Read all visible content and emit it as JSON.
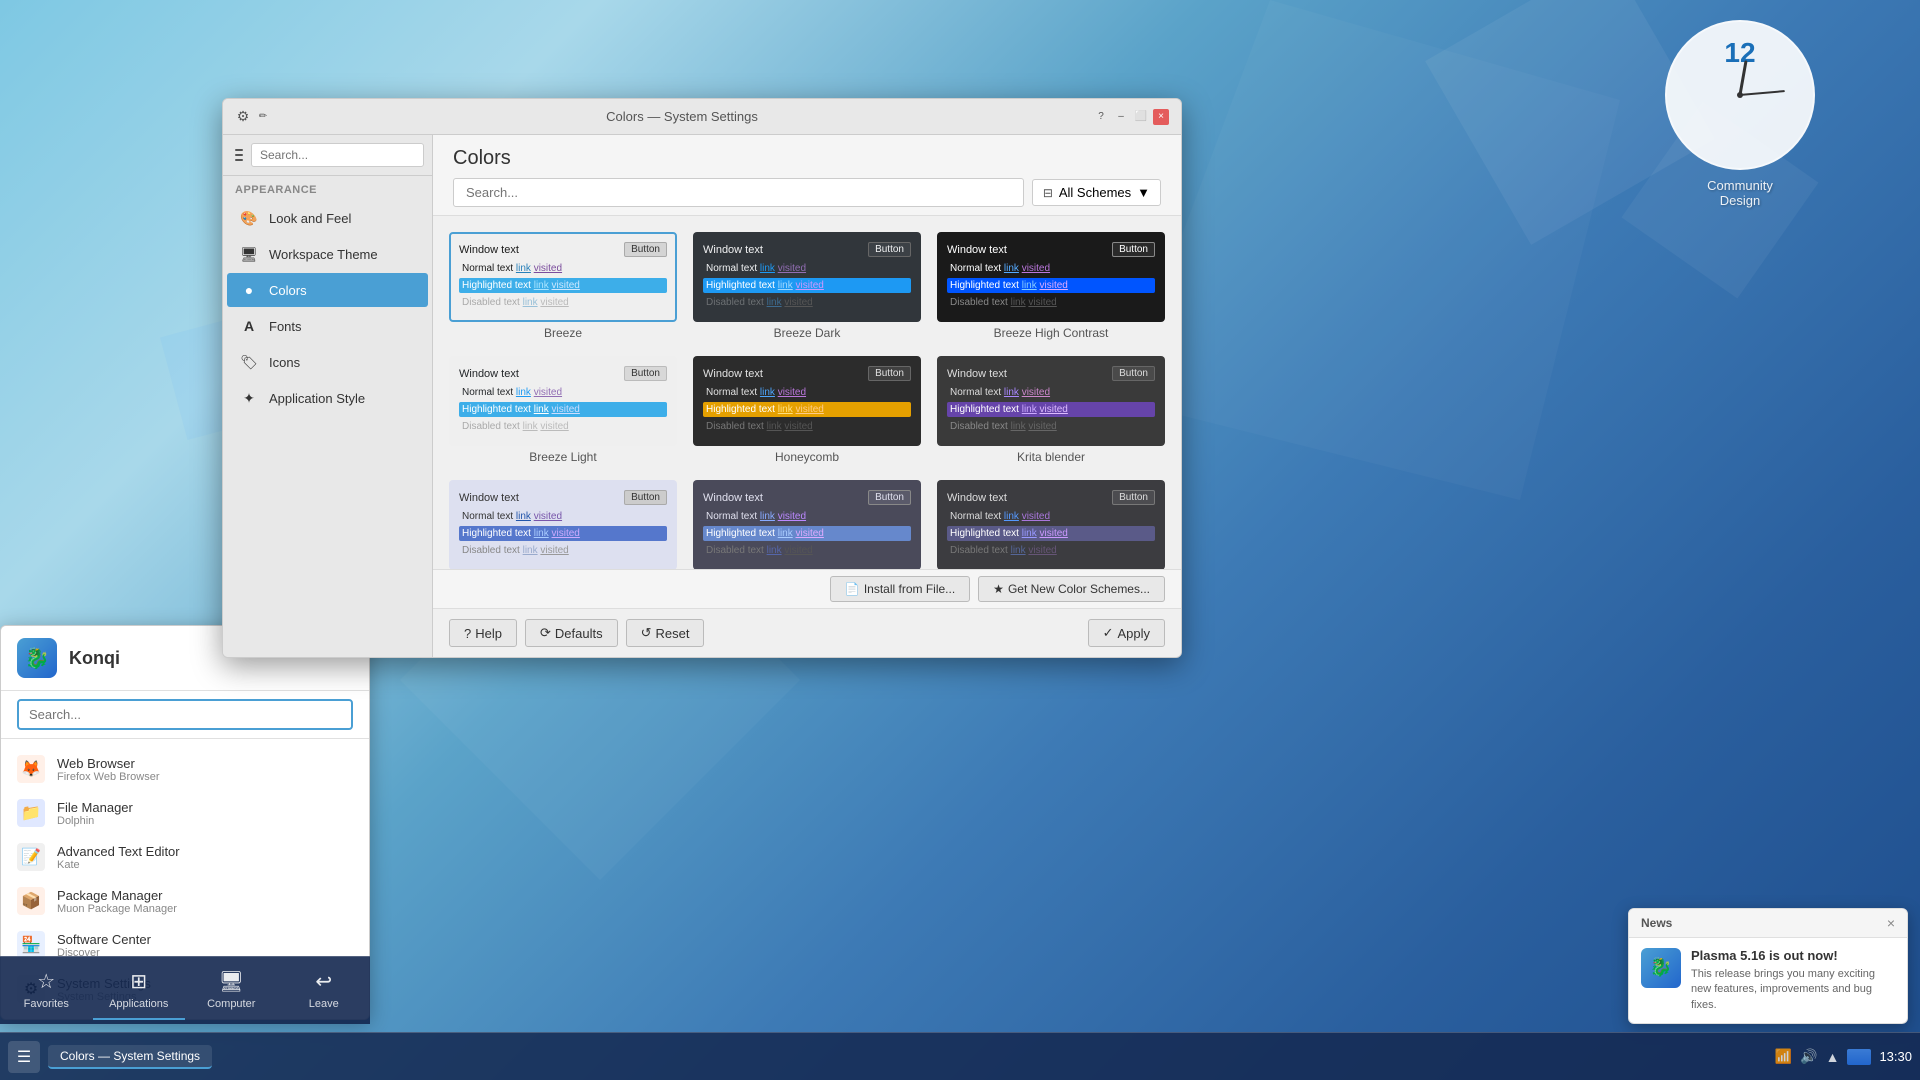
{
  "window": {
    "title": "Colors — System Settings",
    "controls": {
      "close": "×",
      "minimize": "–",
      "maximize": "⬜"
    }
  },
  "sidebar": {
    "search_placeholder": "Search...",
    "section_label": "Appearance",
    "items": [
      {
        "id": "look-and-feel",
        "label": "Look and Feel",
        "icon": "🎨"
      },
      {
        "id": "workspace-theme",
        "label": "Workspace Theme",
        "icon": "🖥"
      },
      {
        "id": "colors",
        "label": "Colors",
        "icon": "🎨",
        "active": true
      },
      {
        "id": "fonts",
        "label": "Fonts",
        "icon": "A"
      },
      {
        "id": "icons",
        "label": "Icons",
        "icon": "🏷"
      },
      {
        "id": "application-style",
        "label": "Application Style",
        "icon": "✦"
      }
    ]
  },
  "content": {
    "title": "Colors",
    "search_placeholder": "Search...",
    "filter_label": "All Schemes",
    "filter_icon": "▼"
  },
  "schemes": [
    {
      "id": "breeze",
      "label": "Breeze",
      "selected": true,
      "theme": "breeze",
      "window_text": "Window text",
      "button_label": "Button",
      "normal_text": "Normal text",
      "link_text": "link",
      "visited_text": "visited",
      "highlight_text": "Highlighted text",
      "highlight_link": "link",
      "highlight_visited": "visited",
      "disabled_text": "Disabled text",
      "disabled_link": "link",
      "disabled_visited": "visited"
    },
    {
      "id": "breeze-dark",
      "label": "Breeze Dark",
      "selected": false,
      "theme": "breeze-dark",
      "window_text": "Window text",
      "button_label": "Button",
      "normal_text": "Normal text",
      "link_text": "link",
      "visited_text": "visited",
      "highlight_text": "Highlighted text",
      "highlight_link": "link",
      "highlight_visited": "visited",
      "disabled_text": "Disabled text",
      "disabled_link": "link",
      "disabled_visited": "visited"
    },
    {
      "id": "breeze-high-contrast",
      "label": "Breeze High Contrast",
      "selected": false,
      "theme": "breeze-hc",
      "window_text": "Window text",
      "button_label": "Button",
      "normal_text": "Normal text",
      "link_text": "link",
      "visited_text": "visited",
      "highlight_text": "Highlighted text",
      "highlight_link": "link",
      "highlight_visited": "visited",
      "disabled_text": "Disabled text",
      "disabled_link": "link",
      "disabled_visited": "visited"
    },
    {
      "id": "breeze-light",
      "label": "Breeze Light",
      "selected": false,
      "theme": "breeze-light",
      "window_text": "Window text",
      "button_label": "Button",
      "normal_text": "Normal text",
      "link_text": "link",
      "visited_text": "visited",
      "highlight_text": "Highlighted text",
      "highlight_link": "link",
      "highlight_visited": "visited",
      "disabled_text": "Disabled text",
      "disabled_link": "link",
      "disabled_visited": "visited"
    },
    {
      "id": "honeycomb",
      "label": "Honeycomb",
      "selected": false,
      "theme": "honeycomb",
      "window_text": "Window text",
      "button_label": "Button",
      "normal_text": "Normal text",
      "link_text": "link",
      "visited_text": "visited",
      "highlight_text": "Highlighted text",
      "highlight_link": "link",
      "highlight_visited": "visited",
      "disabled_text": "Disabled text",
      "disabled_link": "link",
      "disabled_visited": "visited"
    },
    {
      "id": "krita-blender",
      "label": "Krita blender",
      "selected": false,
      "theme": "krita",
      "window_text": "Window text",
      "button_label": "Button",
      "normal_text": "Normal text",
      "link_text": "link",
      "visited_text": "visited",
      "highlight_text": "Highlighted text",
      "highlight_link": "link",
      "highlight_visited": "visited",
      "disabled_text": "Disabled text",
      "disabled_link": "link",
      "disabled_visited": "visited"
    },
    {
      "id": "scheme7",
      "label": "",
      "theme": "r3a"
    },
    {
      "id": "scheme8",
      "label": "",
      "theme": "r3b"
    },
    {
      "id": "scheme9",
      "label": "",
      "theme": "r3c"
    }
  ],
  "bottom_actions": {
    "install_label": "Install from File...",
    "get_new_label": "Get New Color Schemes...",
    "help_label": "Help",
    "defaults_label": "Defaults",
    "reset_label": "Reset",
    "apply_label": "Apply"
  },
  "konqi": {
    "title": "Konqi",
    "search_placeholder": "Search...",
    "apps": [
      {
        "name": "Web Browser",
        "desc": "Firefox Web Browser",
        "icon": "🦊",
        "bg": "#e8f0fe"
      },
      {
        "name": "File Manager",
        "desc": "Dolphin",
        "icon": "📁",
        "bg": "#e0e8ff"
      },
      {
        "name": "Advanced Text Editor",
        "desc": "Kate",
        "icon": "📝",
        "bg": "#f0f0f0"
      },
      {
        "name": "Package Manager",
        "desc": "Muon Package Manager",
        "icon": "📦",
        "bg": "#fff0e8"
      },
      {
        "name": "Software Center",
        "desc": "Discover",
        "icon": "🏪",
        "bg": "#e8f0ff"
      },
      {
        "name": "System Settings",
        "desc": "System Settings",
        "icon": "⚙",
        "bg": "#f0f0f0"
      }
    ],
    "launcher_items": [
      {
        "id": "favorites",
        "label": "Favorites",
        "icon": "☆"
      },
      {
        "id": "applications",
        "label": "Applications",
        "icon": "⊞"
      },
      {
        "id": "computer",
        "label": "Computer",
        "icon": "🖥"
      },
      {
        "id": "leave",
        "label": "Leave",
        "icon": "↩"
      }
    ]
  },
  "notification": {
    "title": "News",
    "headline": "Plasma 5.16 is out now!",
    "text": "This release brings you many exciting new features, improvements and bug fixes."
  },
  "taskbar": {
    "app_label": "Colors — System Settings",
    "time": "13:30"
  },
  "clock": {
    "number": "12",
    "label": "Community\nDesign"
  }
}
